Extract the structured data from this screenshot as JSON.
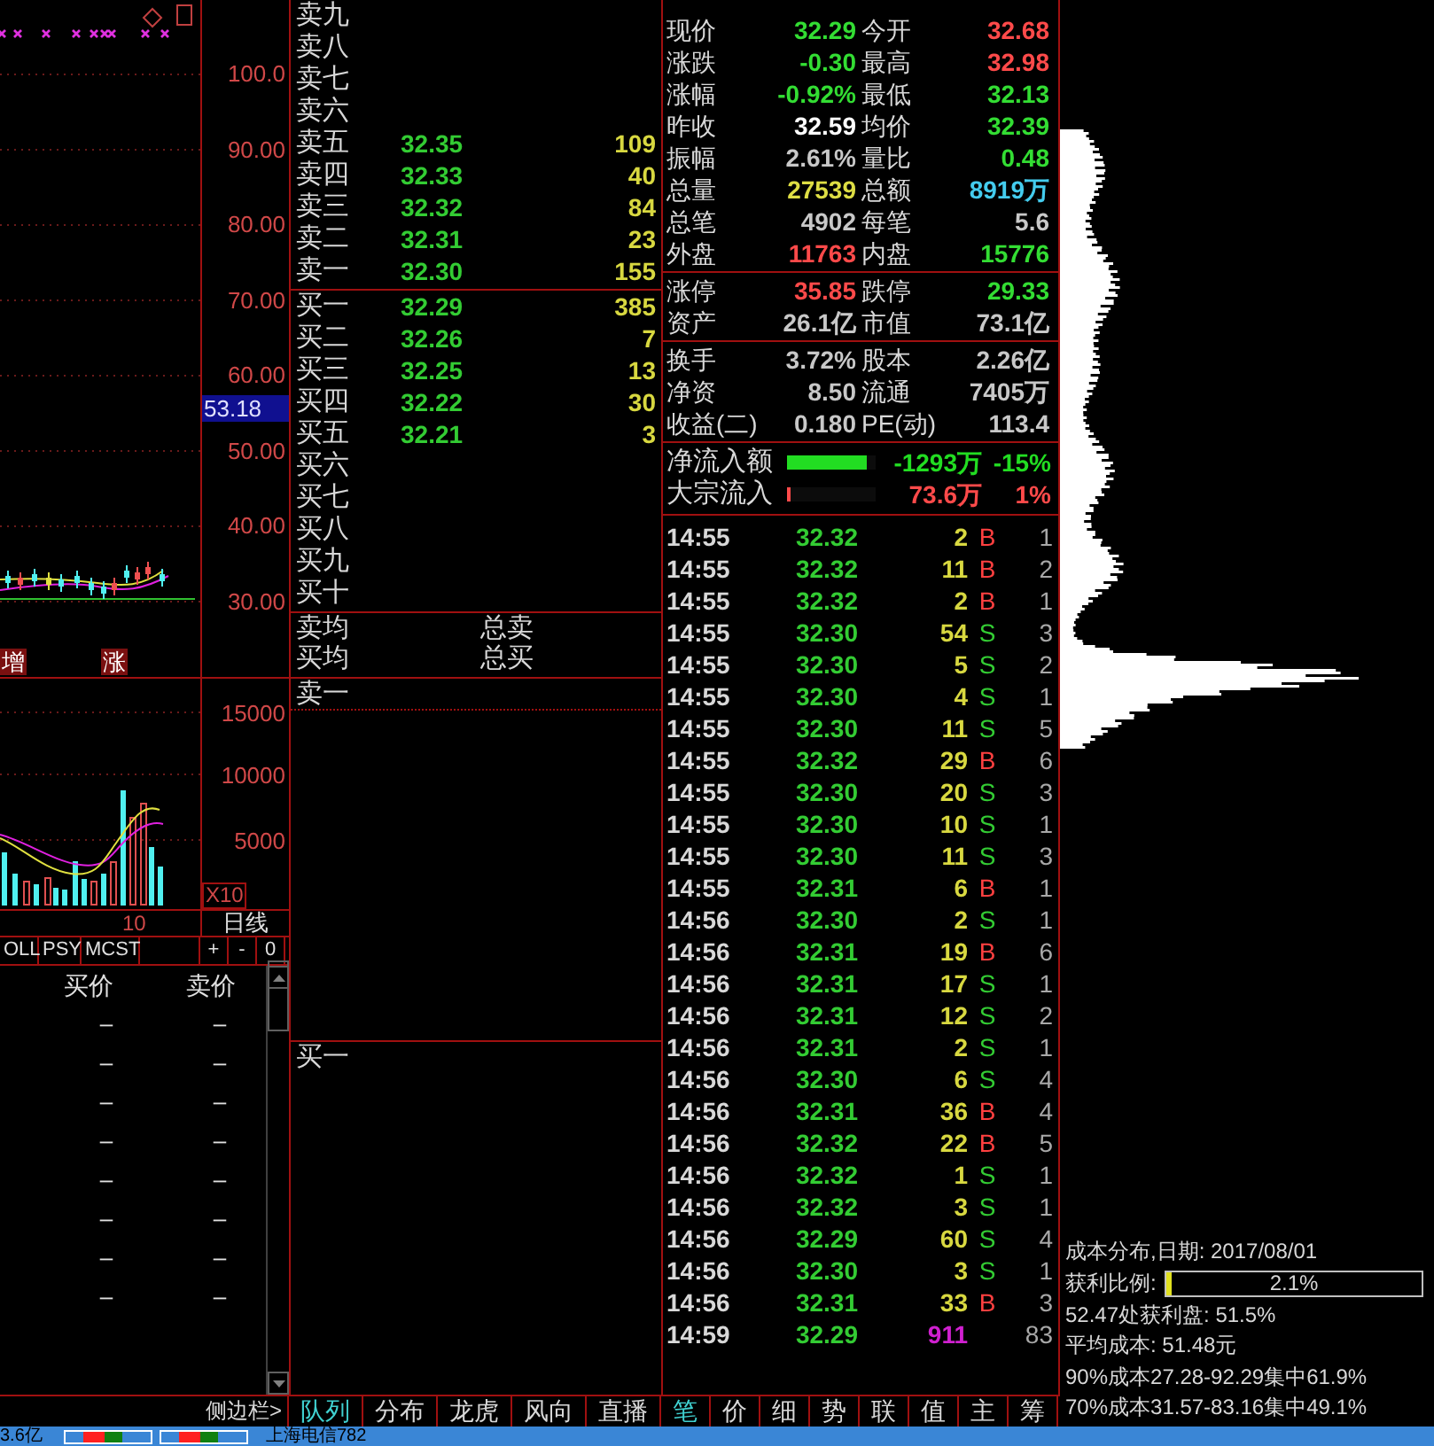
{
  "kline_chart": {
    "price_axis": [
      "100.0",
      "90.00",
      "80.00",
      "70.00",
      "60.00",
      "50.00",
      "40.00",
      "30.00"
    ],
    "current_price_tag": "53.18",
    "signals": [
      "增",
      "涨"
    ]
  },
  "volume_chart": {
    "axis": [
      "15000",
      "10000",
      "5000"
    ],
    "scale_label": "X10"
  },
  "date_label": "10",
  "period": "日线",
  "indicator_tabs": [
    "OLL",
    "PSY",
    "MCST"
  ],
  "zoom_buttons": [
    "+",
    "-",
    "0"
  ],
  "price_list": {
    "columns": [
      "买价",
      "卖价"
    ],
    "rows": [
      [
        "–",
        "–"
      ],
      [
        "–",
        "–"
      ],
      [
        "–",
        "–"
      ],
      [
        "–",
        "–"
      ],
      [
        "–",
        "–"
      ],
      [
        "–",
        "–"
      ],
      [
        "–",
        "–"
      ],
      [
        "–",
        "–"
      ]
    ]
  },
  "order_book": {
    "asks": [
      {
        "label": "卖九"
      },
      {
        "label": "卖八"
      },
      {
        "label": "卖七"
      },
      {
        "label": "卖六"
      },
      {
        "label": "卖五",
        "price": "32.35",
        "volume": "109"
      },
      {
        "label": "卖四",
        "price": "32.33",
        "volume": "40"
      },
      {
        "label": "卖三",
        "price": "32.32",
        "volume": "84"
      },
      {
        "label": "卖二",
        "price": "32.31",
        "volume": "23"
      },
      {
        "label": "卖一",
        "price": "32.30",
        "volume": "155"
      }
    ],
    "bids": [
      {
        "label": "买一",
        "price": "32.29",
        "volume": "385"
      },
      {
        "label": "买二",
        "price": "32.26",
        "volume": "7"
      },
      {
        "label": "买三",
        "price": "32.25",
        "volume": "13"
      },
      {
        "label": "买四",
        "price": "32.22",
        "volume": "30"
      },
      {
        "label": "买五",
        "price": "32.21",
        "volume": "3"
      },
      {
        "label": "买六"
      },
      {
        "label": "买七"
      },
      {
        "label": "买八"
      },
      {
        "label": "买九"
      },
      {
        "label": "买十"
      }
    ],
    "summary": [
      [
        "卖均",
        "总卖"
      ],
      [
        "买均",
        "总买"
      ]
    ],
    "queue": [
      "卖一",
      "买一"
    ]
  },
  "quote": {
    "sections": [
      [
        {
          "label": "现价",
          "value": "32.29",
          "color": "#33dd33"
        },
        {
          "label": "今开",
          "value": "32.68",
          "color": "#ff4a4a"
        },
        {
          "label": "涨跌",
          "value": "-0.30",
          "color": "#33dd33"
        },
        {
          "label": "最高",
          "value": "32.98",
          "color": "#ff4a4a"
        },
        {
          "label": "涨幅",
          "value": "-0.92%",
          "color": "#33dd33"
        },
        {
          "label": "最低",
          "value": "32.13",
          "color": "#33dd33"
        },
        {
          "label": "昨收",
          "value": "32.59",
          "color": "#ffffff"
        },
        {
          "label": "均价",
          "value": "32.39",
          "color": "#33dd33"
        },
        {
          "label": "振幅",
          "value": "2.61%",
          "color": "#c8c8c8"
        },
        {
          "label": "量比",
          "value": "0.48",
          "color": "#33dd33"
        },
        {
          "label": "总量",
          "value": "27539",
          "color": "#dede44"
        },
        {
          "label": "总额",
          "value": "8919万",
          "color": "#44ccee"
        },
        {
          "label": "总笔",
          "value": "4902",
          "color": "#c8c8c8"
        },
        {
          "label": "每笔",
          "value": "5.6",
          "color": "#c8c8c8"
        },
        {
          "label": "外盘",
          "value": "11763",
          "color": "#ff4a4a"
        },
        {
          "label": "内盘",
          "value": "15776",
          "color": "#33dd33"
        }
      ],
      [
        {
          "label": "涨停",
          "value": "35.85",
          "color": "#ff4a4a"
        },
        {
          "label": "跌停",
          "value": "29.33",
          "color": "#33dd33"
        },
        {
          "label": "资产",
          "value": "26.1亿",
          "color": "#c8c8c8"
        },
        {
          "label": "市值",
          "value": "73.1亿",
          "color": "#c8c8c8"
        }
      ],
      [
        {
          "label": "换手",
          "value": "3.72%",
          "color": "#c8c8c8"
        },
        {
          "label": "股本",
          "value": "2.26亿",
          "color": "#c8c8c8"
        },
        {
          "label": "净资",
          "value": "8.50",
          "color": "#c8c8c8"
        },
        {
          "label": "流通",
          "value": "7405万",
          "color": "#c8c8c8"
        },
        {
          "label": "收益(二)",
          "value": "0.180",
          "color": "#c8c8c8"
        },
        {
          "label": "PE(动)",
          "value": "113.4",
          "color": "#c8c8c8"
        }
      ]
    ]
  },
  "fund_flow": [
    {
      "label": "净流入额",
      "level": 0.9,
      "amount": "-1293万",
      "percent": "-15%",
      "color": "#22dd22"
    },
    {
      "label": "大宗流入",
      "level": 0.04,
      "amount": "73.6万",
      "percent": "1%",
      "color": "#ff4a4a"
    }
  ],
  "trades": [
    {
      "time": "14:55",
      "price": "32.32",
      "volume": "2",
      "side": "B",
      "count": "1",
      "kind": "tick"
    },
    {
      "time": "14:55",
      "price": "32.32",
      "volume": "11",
      "side": "B",
      "count": "2",
      "kind": "tick"
    },
    {
      "time": "14:55",
      "price": "32.32",
      "volume": "2",
      "side": "B",
      "count": "1",
      "kind": "tick"
    },
    {
      "time": "14:55",
      "price": "32.30",
      "volume": "54",
      "side": "S",
      "count": "3",
      "kind": "tick"
    },
    {
      "time": "14:55",
      "price": "32.30",
      "volume": "5",
      "side": "S",
      "count": "2",
      "kind": "tick"
    },
    {
      "time": "14:55",
      "price": "32.30",
      "volume": "4",
      "side": "S",
      "count": "1",
      "kind": "tick"
    },
    {
      "time": "14:55",
      "price": "32.30",
      "volume": "11",
      "side": "S",
      "count": "5",
      "kind": "tick"
    },
    {
      "time": "14:55",
      "price": "32.32",
      "volume": "29",
      "side": "B",
      "count": "6",
      "kind": "tick"
    },
    {
      "time": "14:55",
      "price": "32.30",
      "volume": "20",
      "side": "S",
      "count": "3",
      "kind": "tick"
    },
    {
      "time": "14:55",
      "price": "32.30",
      "volume": "10",
      "side": "S",
      "count": "1",
      "kind": "tick"
    },
    {
      "time": "14:55",
      "price": "32.30",
      "volume": "11",
      "side": "S",
      "count": "3",
      "kind": "tick"
    },
    {
      "time": "14:55",
      "price": "32.31",
      "volume": "6",
      "side": "B",
      "count": "1",
      "kind": "tick"
    },
    {
      "time": "14:56",
      "price": "32.30",
      "volume": "2",
      "side": "S",
      "count": "1",
      "kind": "tick"
    },
    {
      "time": "14:56",
      "price": "32.31",
      "volume": "19",
      "side": "B",
      "count": "6",
      "kind": "tick"
    },
    {
      "time": "14:56",
      "price": "32.31",
      "volume": "17",
      "side": "S",
      "count": "1",
      "kind": "tick"
    },
    {
      "time": "14:56",
      "price": "32.31",
      "volume": "12",
      "side": "S",
      "count": "2",
      "kind": "tick"
    },
    {
      "time": "14:56",
      "price": "32.31",
      "volume": "2",
      "side": "S",
      "count": "1",
      "kind": "tick"
    },
    {
      "time": "14:56",
      "price": "32.30",
      "volume": "6",
      "side": "S",
      "count": "4",
      "kind": "tick"
    },
    {
      "time": "14:56",
      "price": "32.31",
      "volume": "36",
      "side": "B",
      "count": "4",
      "kind": "tick"
    },
    {
      "time": "14:56",
      "price": "32.32",
      "volume": "22",
      "side": "B",
      "count": "5",
      "kind": "tick"
    },
    {
      "time": "14:56",
      "price": "32.32",
      "volume": "1",
      "side": "S",
      "count": "1",
      "kind": "tick"
    },
    {
      "time": "14:56",
      "price": "32.32",
      "volume": "3",
      "side": "S",
      "count": "1",
      "kind": "tick"
    },
    {
      "time": "14:56",
      "price": "32.29",
      "volume": "60",
      "side": "S",
      "count": "4",
      "kind": "tick"
    },
    {
      "time": "14:56",
      "price": "32.30",
      "volume": "3",
      "side": "S",
      "count": "1",
      "kind": "tick"
    },
    {
      "time": "14:56",
      "price": "32.31",
      "volume": "33",
      "side": "B",
      "count": "3",
      "kind": "tick"
    },
    {
      "time": "14:59",
      "price": "32.29",
      "volume": "911",
      "count": "83",
      "kind": "total"
    }
  ],
  "sidebar_toggle": "侧边栏>",
  "panel_tabs": [
    {
      "label": "队列",
      "selected": true
    },
    {
      "label": "分布",
      "selected": false
    },
    {
      "label": "龙虎",
      "selected": false
    },
    {
      "label": "风向",
      "selected": false
    },
    {
      "label": "直播",
      "selected": false
    }
  ],
  "detail_tabs": [
    {
      "label": "笔",
      "selected": true
    },
    {
      "label": "价",
      "selected": false
    },
    {
      "label": "细",
      "selected": false
    },
    {
      "label": "势",
      "selected": false
    },
    {
      "label": "联",
      "selected": false
    },
    {
      "label": "值",
      "selected": false
    },
    {
      "label": "主",
      "selected": false
    },
    {
      "label": "筹",
      "selected": false
    }
  ],
  "chip_panel": {
    "title": "成本分布,日期: 2017/08/01",
    "profit_ratio": {
      "label": "获利比例:",
      "level": 0.021,
      "value": "2.1%"
    },
    "lines": [
      "52.47处获利盘: 51.5%",
      "平均成本: 51.48元",
      "90%成本27.28-92.29集中61.9%",
      "70%成本31.57-83.16集中49.1%"
    ]
  },
  "status_bar": {
    "turnover": "3.6亿",
    "server": "上海电信782"
  }
}
